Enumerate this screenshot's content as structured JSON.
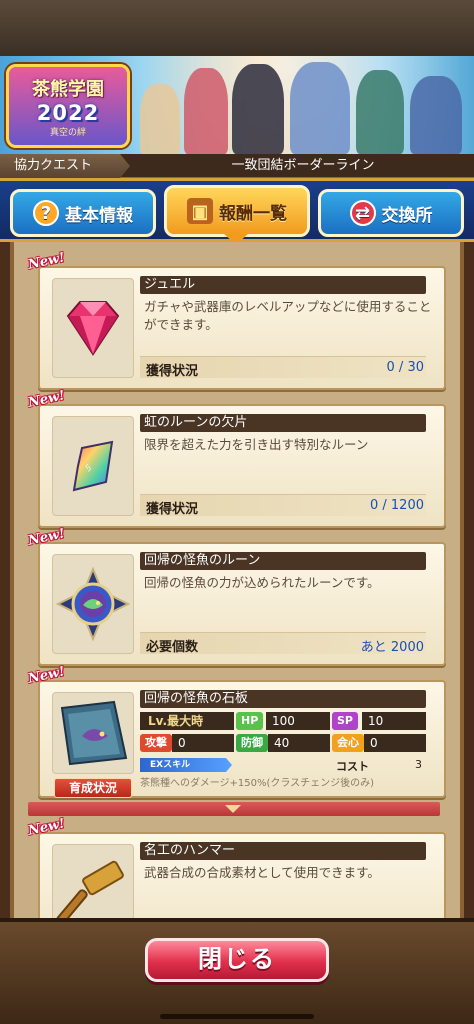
{
  "banner": {
    "logo_line1": "茶熊学園",
    "logo_line2": "2022",
    "logo_line3": "真空の絆"
  },
  "header": {
    "quest_type": "協力クエスト",
    "quest_name": "一致団結ボーダーライン"
  },
  "tabs": [
    {
      "label": "基本情報",
      "icon": "question-icon",
      "active": false
    },
    {
      "label": "報酬一覧",
      "icon": "treasure-chest-icon",
      "active": true
    },
    {
      "label": "交換所",
      "icon": "exchange-icon",
      "active": false
    }
  ],
  "new_badge": "New!",
  "rewards": [
    {
      "name": "ジュエル",
      "description": "ガチャや武器庫のレベルアップなどに使用することができます。",
      "stat_label": "獲得状況",
      "stat_value": "0 / 30",
      "icon": "jewel-icon"
    },
    {
      "name": "虹のルーンの欠片",
      "description": "限界を超えた力を引き出す特別なルーン",
      "stat_label": "獲得状況",
      "stat_value": "0 / 1200",
      "icon": "rainbow-rune-shard-icon"
    },
    {
      "name": "回帰の怪魚のルーン",
      "description": "回帰の怪魚の力が込められたルーンです。",
      "stat_label": "必要個数",
      "stat_value": "あと 2000",
      "icon": "fish-rune-icon"
    },
    {
      "name": "回帰の怪魚の石板",
      "icon": "stone-tablet-icon",
      "level_label": "Lv.",
      "level_value": "最大時",
      "hp_label": "HP",
      "hp_value": "100",
      "sp_label": "SP",
      "sp_value": "10",
      "atk_label": "攻撃",
      "atk_value": "0",
      "def_label": "防御",
      "def_value": "40",
      "crit_label": "会心",
      "crit_value": "0",
      "ex_label": "EXスキル",
      "cost_label": "コスト",
      "cost_value": "3",
      "ex_desc": "茶熊種へのダメージ+150%(クラスチェンジ後のみ)",
      "grow_button": "育成状況"
    },
    {
      "name": "名工のハンマー",
      "description": "武器合成の合成素材として使用できます。",
      "icon": "hammer-icon"
    }
  ],
  "footer": {
    "close_label": "閉じる"
  }
}
